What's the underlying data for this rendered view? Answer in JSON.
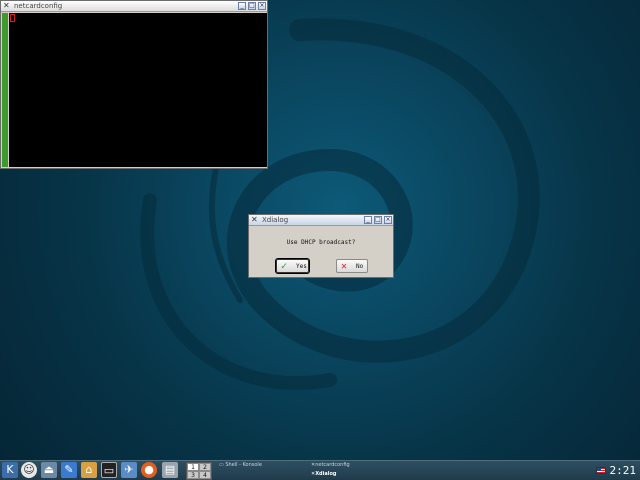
{
  "terminal": {
    "title": "netcardconfig",
    "icon": "kde-icon"
  },
  "dialog": {
    "title": "Xdialog",
    "message": "Use DHCP broadcast?",
    "yes_label": "Yes",
    "no_label": "No",
    "yes_icon": "check-icon",
    "no_icon": "x-icon"
  },
  "window_buttons": {
    "minimize": "_",
    "maximize": "□",
    "close": "×"
  },
  "taskbar": {
    "launchers": [
      "kmenu-icon",
      "knoppix-icon",
      "eject-icon",
      "cleanup-icon",
      "home-icon",
      "terminal-icon",
      "network-icon",
      "firefox-icon",
      "panel-icon"
    ],
    "pager": [
      "1",
      "2",
      "3",
      "4"
    ],
    "active_desktop": "1",
    "tasks": [
      {
        "label": "Shell - Konsole",
        "active": false
      },
      {
        "label": "netcardconfig",
        "active": false
      },
      {
        "label": "Xdialog",
        "active": true
      }
    ],
    "clock": "2:21"
  },
  "colors": {
    "desktop": "#0a4862",
    "terminal_bg": "#000000",
    "terminal_bar": "#3f9a2e",
    "taskbar": "#2e4f61"
  }
}
